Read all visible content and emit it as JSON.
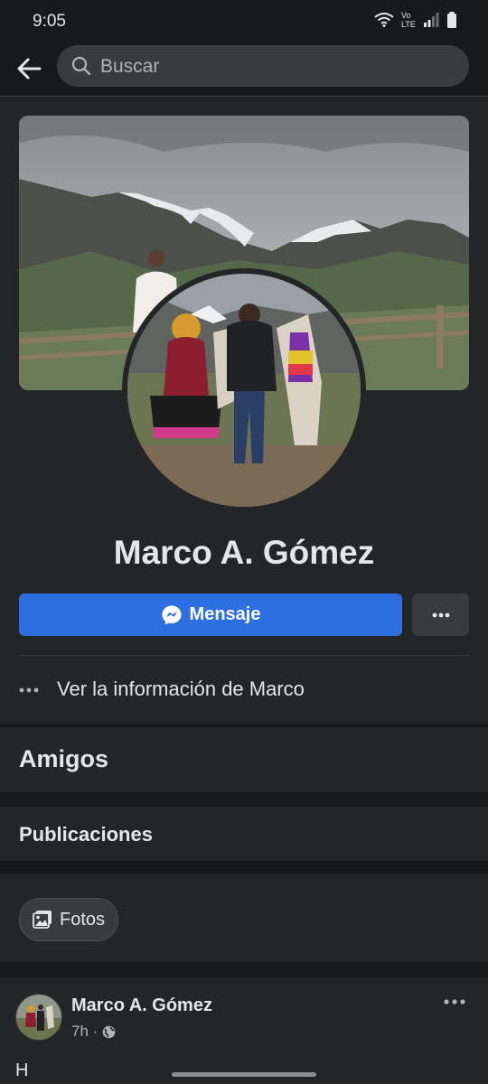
{
  "status_bar": {
    "time": "9:05",
    "network_label": "Vo LTE"
  },
  "search": {
    "placeholder": "Buscar"
  },
  "profile": {
    "name": "Marco A. Gómez",
    "message_button": "Mensaje",
    "info_link": "Ver la información de Marco"
  },
  "sections": {
    "friends": "Amigos",
    "posts": "Publicaciones",
    "photos_chip": "Fotos"
  },
  "post": {
    "author": "Marco A. Gómez",
    "time": "7h ·",
    "text_preview": "H"
  },
  "colors": {
    "background": "#18191a",
    "card": "#242526",
    "accent": "#2d6fe0",
    "input": "#3a3b3c",
    "text": "#e4e6eb",
    "muted": "#b0b3b8"
  },
  "icons": {
    "back": "back-arrow-icon",
    "search": "search-icon",
    "messenger": "messenger-icon",
    "more": "more-icon",
    "photos": "photos-icon",
    "privacy": "globe-icon"
  }
}
